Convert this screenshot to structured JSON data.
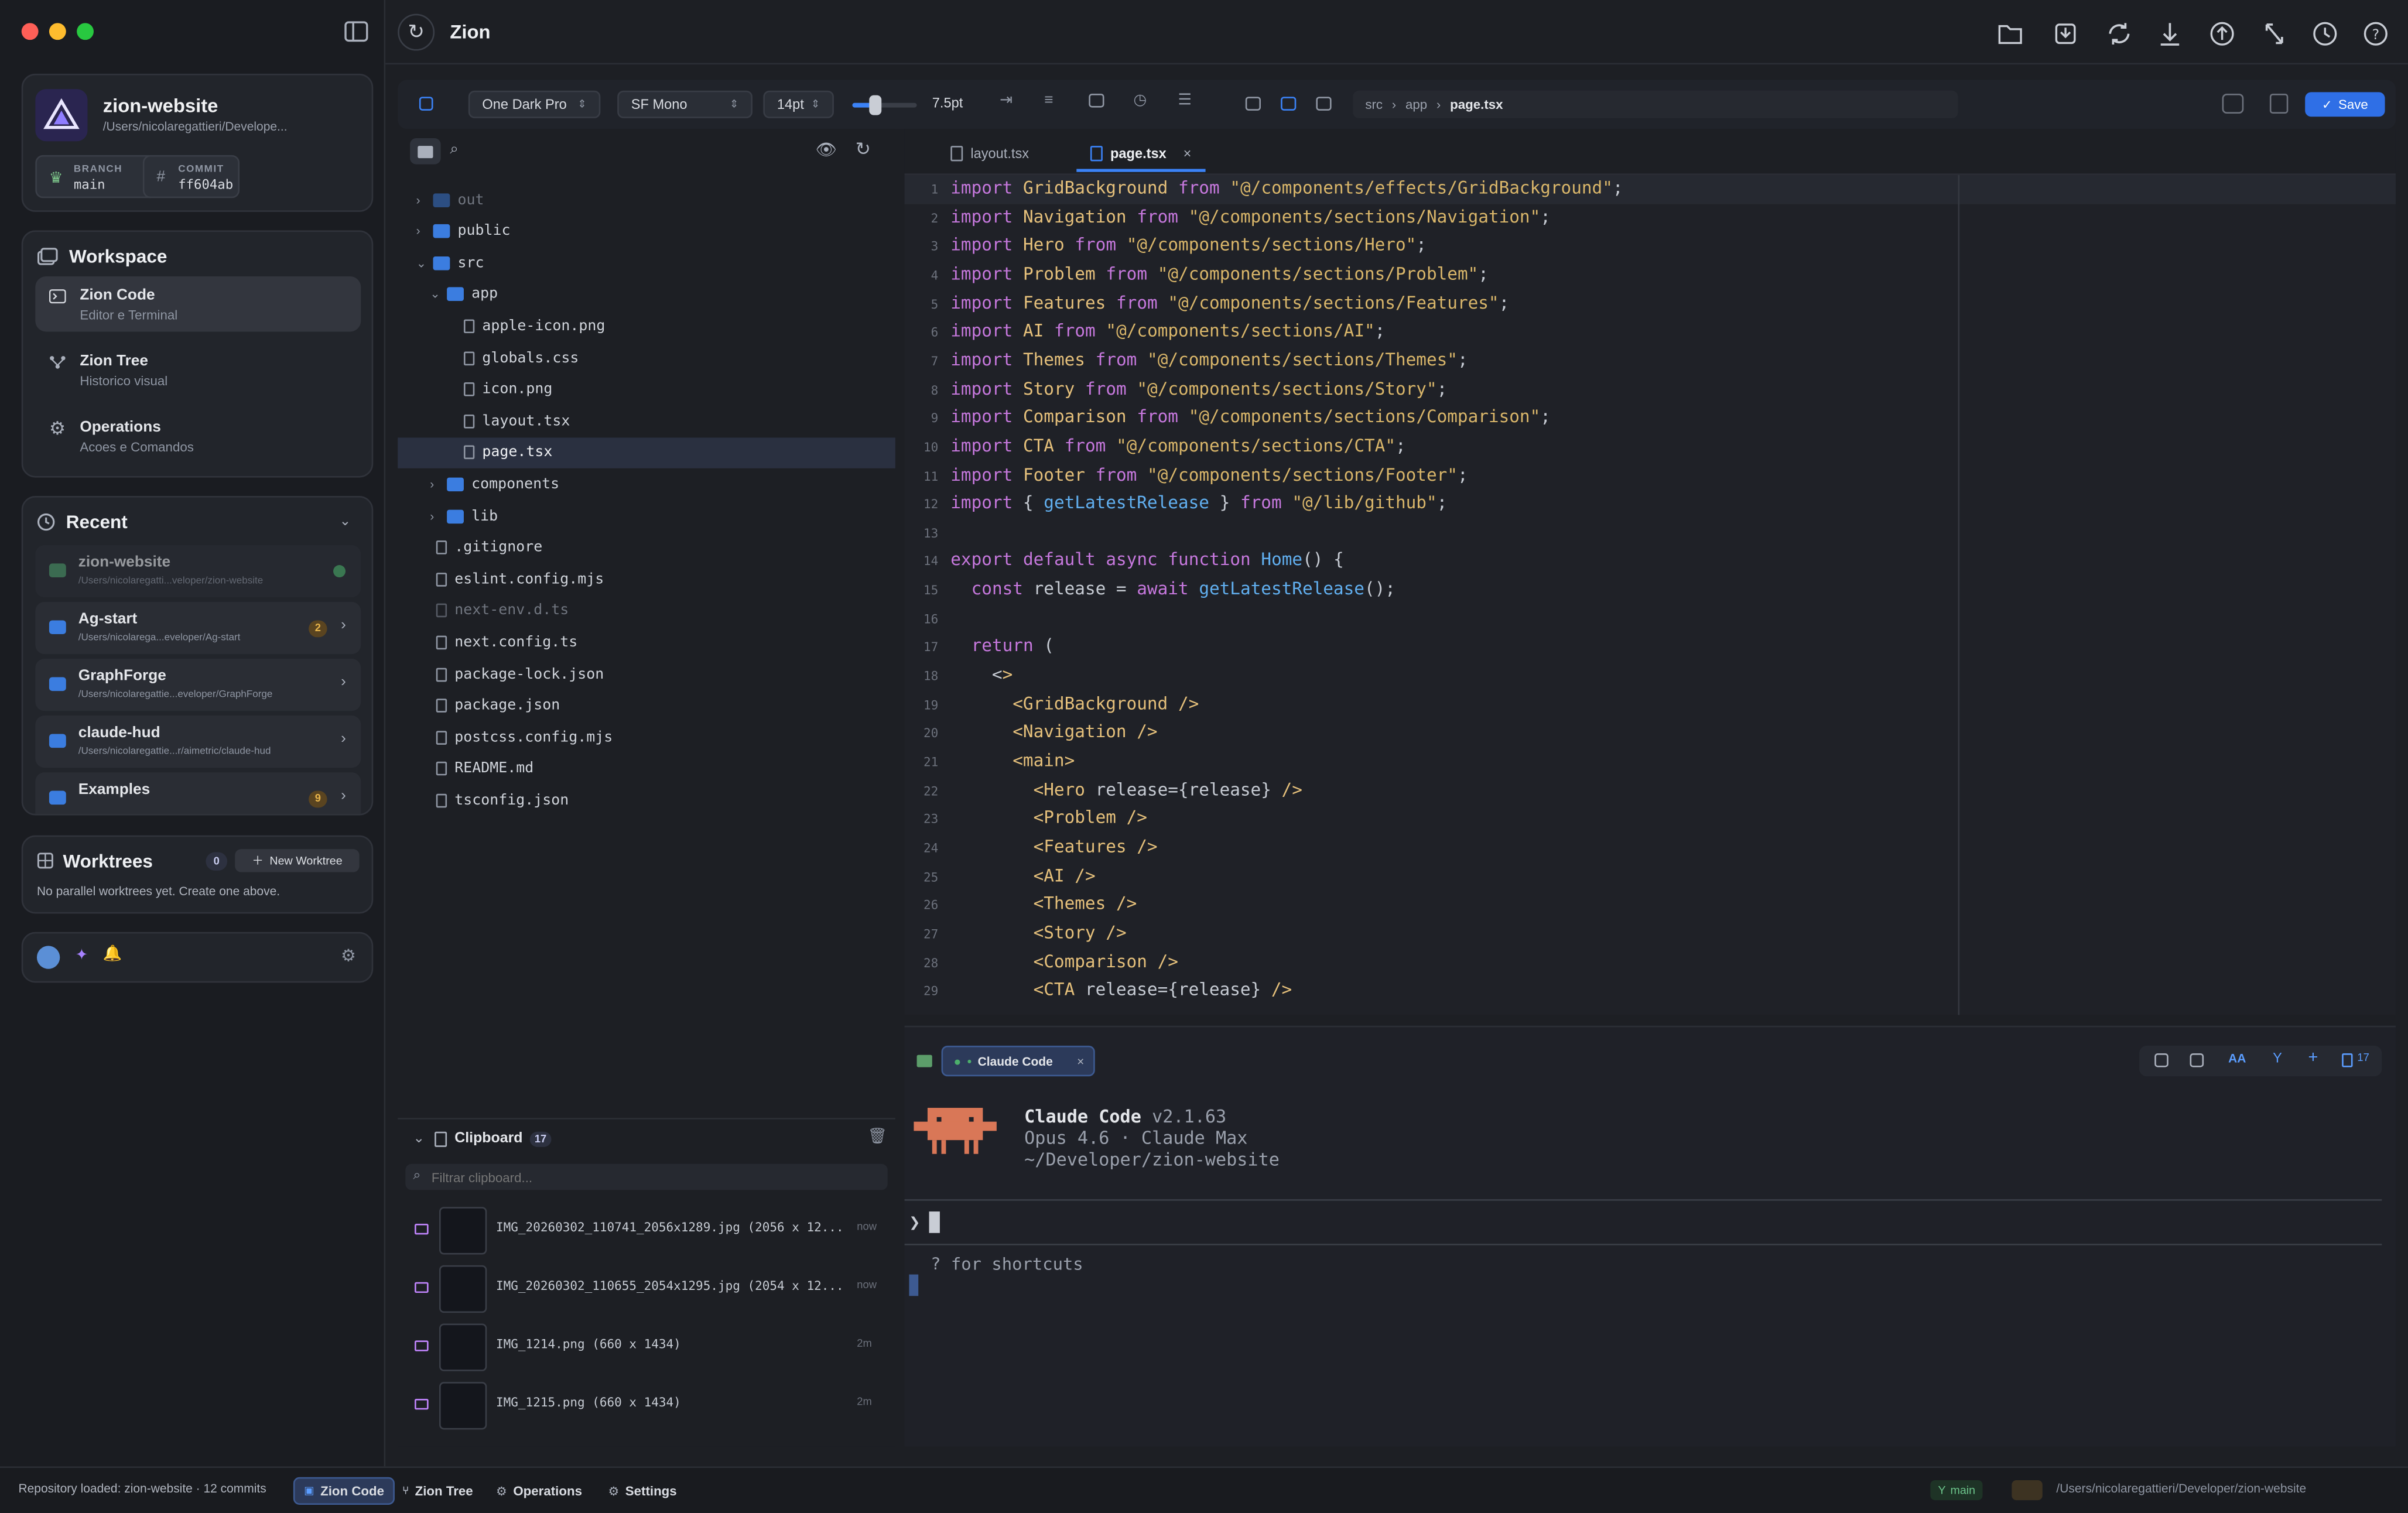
{
  "window_title": "Zion",
  "project": {
    "name": "zion-website",
    "path": "/Users/nicolaregattieri/Develope...",
    "branch_label": "BRANCH",
    "branch": "main",
    "commit_label": "COMMIT",
    "commit": "ff604ab"
  },
  "workspace": {
    "title": "Workspace",
    "items": [
      {
        "title": "Zion Code",
        "subtitle": "Editor e Terminal"
      },
      {
        "title": "Zion Tree",
        "subtitle": "Historico visual"
      },
      {
        "title": "Operations",
        "subtitle": "Acoes e Comandos"
      }
    ]
  },
  "recent": {
    "title": "Recent",
    "items": [
      {
        "name": "zion-website",
        "path": "/Users/nicolaregatti...veloper/zion-website",
        "badge": ""
      },
      {
        "name": "Ag-start",
        "path": "/Users/nicolarega...eveloper/Ag-start",
        "badge": "2"
      },
      {
        "name": "GraphForge",
        "path": "/Users/nicolaregattie...eveloper/GraphForge",
        "badge": ""
      },
      {
        "name": "claude-hud",
        "path": "/Users/nicolaregattie...r/aimetric/claude-hud",
        "badge": ""
      },
      {
        "name": "Examples",
        "path": "",
        "badge": "9"
      }
    ]
  },
  "worktrees": {
    "title": "Worktrees",
    "count": "0",
    "new_button": "New Worktree",
    "empty": "No parallel worktrees yet. Create one above."
  },
  "toolbar": {
    "theme": "One Dark Pro",
    "font": "SF Mono",
    "size": "14pt",
    "spacing": "7.5pt",
    "spacing_fraction": 0.35,
    "breadcrumb": [
      "src",
      "app",
      "page.tsx"
    ],
    "save": "Save"
  },
  "tree": [
    {
      "name": "out",
      "type": "folder",
      "depth": 0,
      "arrow": "closed",
      "dim": true
    },
    {
      "name": "public",
      "type": "folder",
      "depth": 0,
      "arrow": "closed"
    },
    {
      "name": "src",
      "type": "folder",
      "depth": 0,
      "arrow": "open"
    },
    {
      "name": "app",
      "type": "folder",
      "depth": 1,
      "arrow": "open"
    },
    {
      "name": "apple-icon.png",
      "type": "file",
      "depth": 2
    },
    {
      "name": "globals.css",
      "type": "file",
      "depth": 2
    },
    {
      "name": "icon.png",
      "type": "file",
      "depth": 2
    },
    {
      "name": "layout.tsx",
      "type": "file",
      "depth": 2
    },
    {
      "name": "page.tsx",
      "type": "file",
      "depth": 2,
      "selected": true
    },
    {
      "name": "components",
      "type": "folder",
      "depth": 1,
      "arrow": "closed"
    },
    {
      "name": "lib",
      "type": "folder",
      "depth": 1,
      "arrow": "closed"
    },
    {
      "name": ".gitignore",
      "type": "file",
      "depth": 0
    },
    {
      "name": "eslint.config.mjs",
      "type": "file",
      "depth": 0
    },
    {
      "name": "next-env.d.ts",
      "type": "file",
      "depth": 0,
      "dim": true
    },
    {
      "name": "next.config.ts",
      "type": "file",
      "depth": 0
    },
    {
      "name": "package-lock.json",
      "type": "file",
      "depth": 0
    },
    {
      "name": "package.json",
      "type": "file",
      "depth": 0
    },
    {
      "name": "postcss.config.mjs",
      "type": "file",
      "depth": 0
    },
    {
      "name": "README.md",
      "type": "file",
      "depth": 0
    },
    {
      "name": "tsconfig.json",
      "type": "file",
      "depth": 0
    }
  ],
  "tabs": [
    {
      "name": "layout.tsx",
      "active": false
    },
    {
      "name": "page.tsx",
      "active": true
    }
  ],
  "code": [
    "import GridBackground from \"@/components/effects/GridBackground\";",
    "import Navigation from \"@/components/sections/Navigation\";",
    "import Hero from \"@/components/sections/Hero\";",
    "import Problem from \"@/components/sections/Problem\";",
    "import Features from \"@/components/sections/Features\";",
    "import AI from \"@/components/sections/AI\";",
    "import Themes from \"@/components/sections/Themes\";",
    "import Story from \"@/components/sections/Story\";",
    "import Comparison from \"@/components/sections/Comparison\";",
    "import CTA from \"@/components/sections/CTA\";",
    "import Footer from \"@/components/sections/Footer\";",
    "import { getLatestRelease } from \"@/lib/github\";",
    "",
    "export default async function Home() {",
    "  const release = await getLatestRelease();",
    "",
    "  return (",
    "    <>",
    "      <GridBackground />",
    "      <Navigation />",
    "      <main>",
    "        <Hero release={release} />",
    "        <Problem />",
    "        <Features />",
    "        <AI />",
    "        <Themes />",
    "        <Story />",
    "        <Comparison />",
    "        <CTA release={release} />"
  ],
  "terminal": {
    "tab": "Claude Code",
    "app": "Claude Code",
    "version": "v2.1.63",
    "model": "Opus 4.6 · Claude Max",
    "cwd": "~/Developer/zion-website",
    "prompt": "❯",
    "hint": "? for shortcuts",
    "count": "17"
  },
  "clipboard": {
    "title": "Clipboard",
    "count": "17",
    "placeholder": "Filtrar clipboard...",
    "items": [
      {
        "name": "IMG_20260302_110741_2056x1289.jpg (2056 x 12...",
        "time": "now"
      },
      {
        "name": "IMG_20260302_110655_2054x1295.jpg (2054 x 12...",
        "time": "now"
      },
      {
        "name": "IMG_1214.png (660 x 1434)",
        "time": "2m"
      },
      {
        "name": "IMG_1215.png (660 x 1434)",
        "time": "2m"
      }
    ]
  },
  "status": {
    "message": "Repository loaded: zion-website · 12 commits",
    "tabs": [
      "Zion Code",
      "Zion Tree",
      "Operations",
      "Settings"
    ],
    "branch": "main",
    "path": "/Users/nicolaregattieri/Developer/zion-website"
  },
  "colors": {
    "accent": "#3b82f6",
    "bg": "#1d1f24",
    "keyword": "#c678dd",
    "string": "#d9b66a",
    "identifier": "#e5c07b"
  }
}
